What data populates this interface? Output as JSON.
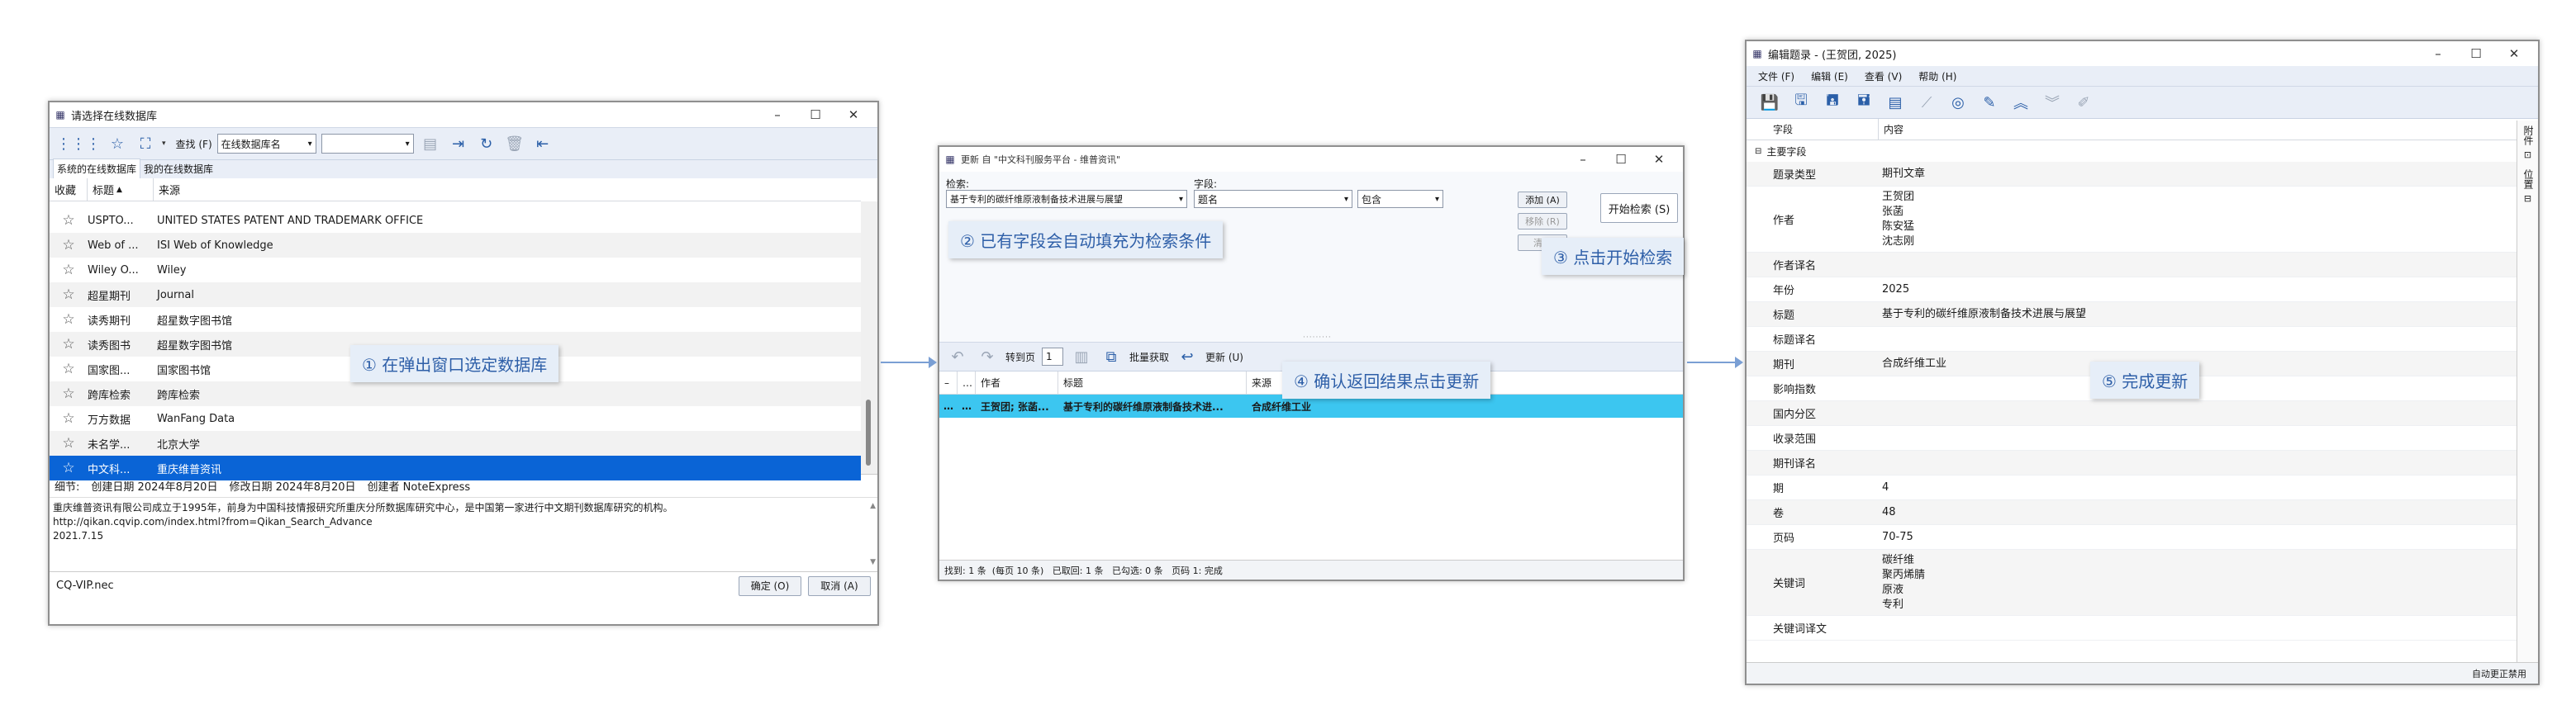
{
  "db_window": {
    "title": "请选择在线数据库",
    "toolbar": {
      "find_label": "查找",
      "find_key": "(F)",
      "field_select": "在线数据库名",
      "search_value": ""
    },
    "tabs": [
      "系统的在线数据库",
      "我的在线数据库"
    ],
    "columns": [
      "收藏",
      "标题",
      "来源"
    ],
    "rows": [
      {
        "title": "USPTO...",
        "source": "UNITED STATES PATENT AND TRADEMARK OFFICE"
      },
      {
        "title": "Web of ...",
        "source": "ISI Web of Knowledge"
      },
      {
        "title": "Wiley O...",
        "source": "Wiley"
      },
      {
        "title": "超星期刊",
        "source": "Journal"
      },
      {
        "title": "读秀期刊",
        "source": "超星数字图书馆"
      },
      {
        "title": "读秀图书",
        "source": "超星数字图书馆"
      },
      {
        "title": "国家图...",
        "source": "国家图书馆"
      },
      {
        "title": "跨库检索",
        "source": "跨库检索"
      },
      {
        "title": "万方数据",
        "source": "WanFang Data"
      },
      {
        "title": "未名学...",
        "source": "北京大学"
      },
      {
        "title": "中文科...",
        "source": "重庆维普资讯"
      }
    ],
    "detail": {
      "label": "细节:",
      "created_label": "创建日期",
      "created": "2024年8月20日",
      "modified_label": "修改日期",
      "modified": "2024年8月20日",
      "author_label": "创建者",
      "author": "NoteExpress",
      "line1": "重庆维普资讯有限公司成立于1995年，前身为中国科技情报研究所重庆分所数据库研究中心，是中国第一家进行中文期刊数据库研究的机构。",
      "line2": "http://qikan.cqvip.com/index.html?from=Qikan_Search_Advance",
      "line3": "2021.7.15"
    },
    "footer_file": "CQ-VIP.nec",
    "ok_label": "确定 (O)",
    "cancel_label": "取消 (A)"
  },
  "update_window": {
    "title": "更新 自 \"中文科刊服务平台 - 维普资讯\"",
    "search_label": "检索:",
    "field_label": "字段:",
    "search_value": "基于专利的碳纤维原液制备技术进展与展望",
    "field_value": "题名",
    "match_value": "包含",
    "add_label": "添加 (A)",
    "remove_label": "移除 (R)",
    "clear_label": "清除",
    "start_label": "开始检索 (S)",
    "goto_label": "转到页",
    "page_value": "1",
    "batch_label": "批量获取",
    "update_label": "更新 (U)",
    "result_columns": [
      "作者",
      "标题",
      "来源"
    ],
    "result_row": {
      "author": "王贺团; 张菡...",
      "title": "基于专利的碳纤维原液制备技术进...",
      "source": "合成纤维工业"
    },
    "status": "找到: 1 条  (每页 10 条)   已取回: 1 条   已勾选: 0 条   页码 1: 完成"
  },
  "edit_window": {
    "title": "编辑题录 - (王贺团, 2025)",
    "menu": [
      "文件 (F)",
      "编辑 (E)",
      "查看 (V)",
      "帮助 (H)"
    ],
    "columns": [
      "字段",
      "内容"
    ],
    "group_label": "主要字段",
    "side_tab": "附件",
    "side_tab2": "位置",
    "fields": [
      {
        "k": "题录类型",
        "v": [
          "期刊文章"
        ]
      },
      {
        "k": "作者",
        "v": [
          "王贺团",
          "张菡",
          "陈安猛",
          "沈志刚"
        ]
      },
      {
        "k": "作者译名",
        "v": [
          ""
        ]
      },
      {
        "k": "年份",
        "v": [
          "2025"
        ]
      },
      {
        "k": "标题",
        "v": [
          "基于专利的碳纤维原液制备技术进展与展望"
        ]
      },
      {
        "k": "标题译名",
        "v": [
          ""
        ]
      },
      {
        "k": "期刊",
        "v": [
          "合成纤维工业"
        ]
      },
      {
        "k": "影响指数",
        "v": [
          ""
        ]
      },
      {
        "k": "国内分区",
        "v": [
          ""
        ]
      },
      {
        "k": "收录范围",
        "v": [
          ""
        ]
      },
      {
        "k": "期刊译名",
        "v": [
          ""
        ]
      },
      {
        "k": "期",
        "v": [
          "4"
        ]
      },
      {
        "k": "卷",
        "v": [
          "48"
        ]
      },
      {
        "k": "页码",
        "v": [
          "70-75"
        ]
      },
      {
        "k": "关键词",
        "v": [
          "碳纤维",
          "聚丙烯腈",
          "原液",
          "专利"
        ]
      },
      {
        "k": "关键词译文",
        "v": [
          ""
        ]
      }
    ],
    "status": "自动更正禁用"
  },
  "callouts": {
    "c1": "① 在弹出窗口选定数据库",
    "c2": "② 已有字段会自动填充为检索条件",
    "c3": "③ 点击开始检索",
    "c4": "④ 确认返回结果点击更新",
    "c5": "⑤ 完成更新"
  }
}
